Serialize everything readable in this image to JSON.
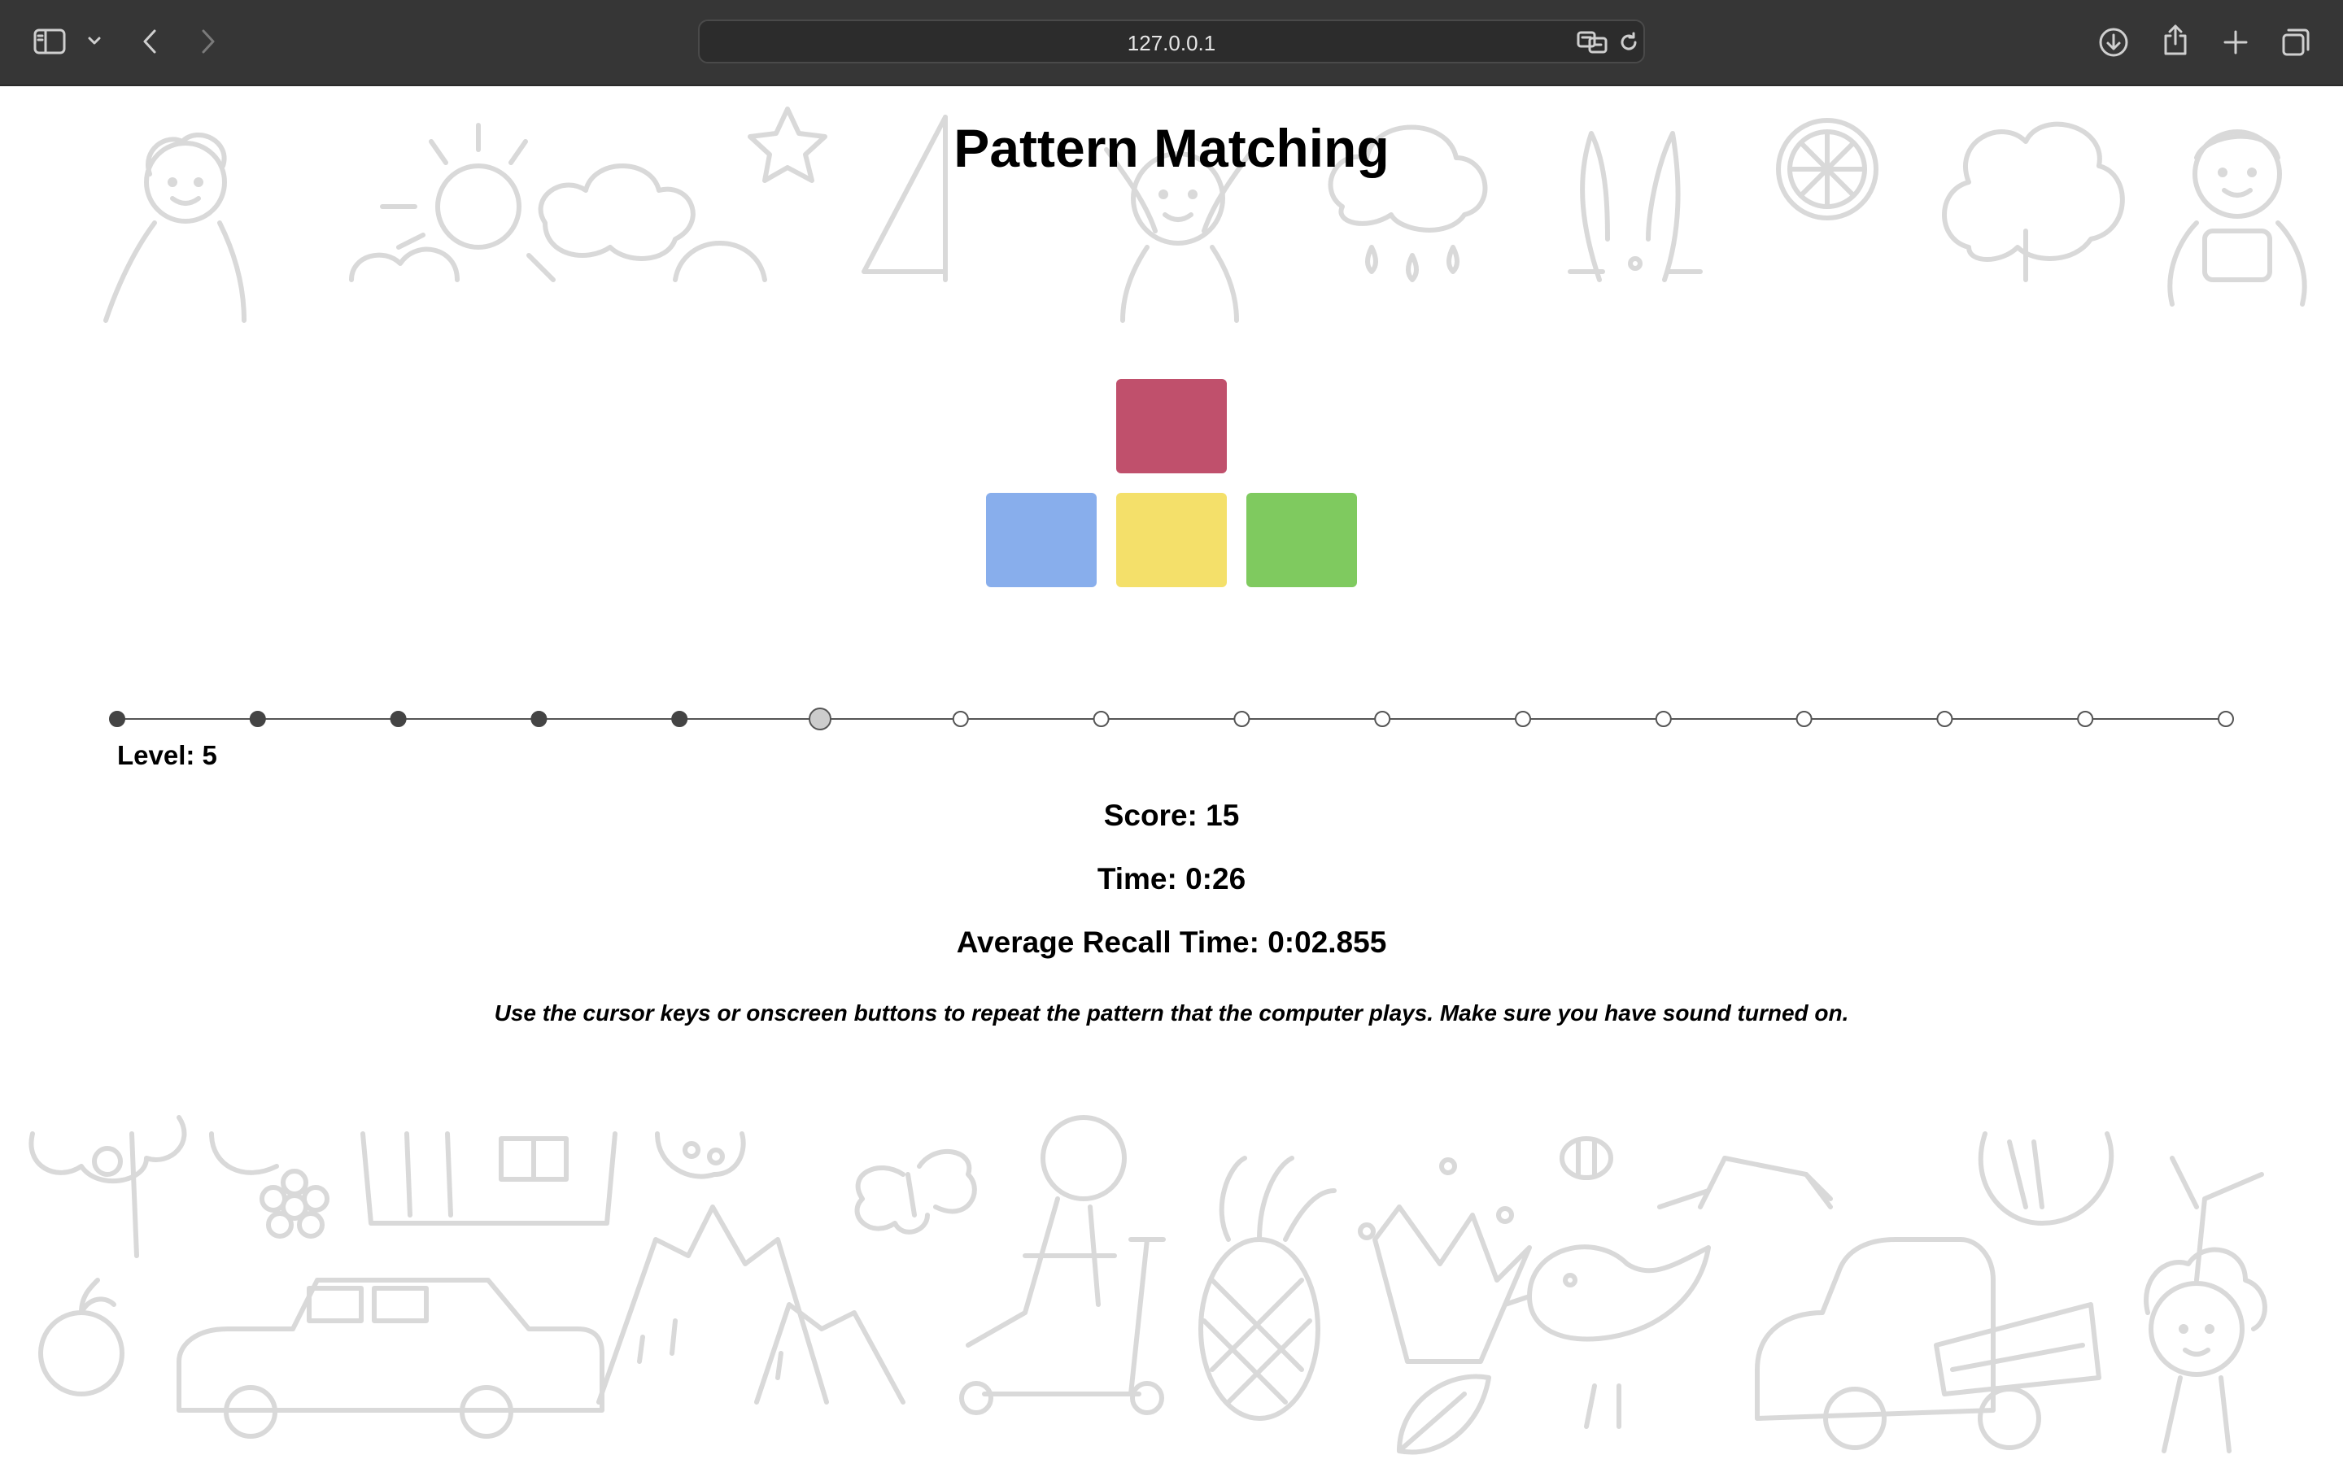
{
  "browser": {
    "url": "127.0.0.1",
    "toolbar_icons": [
      "sidebar-icon",
      "chevron-down-icon",
      "back-icon",
      "forward-icon",
      "translate-icon",
      "reload-icon",
      "download-icon",
      "share-icon",
      "new-tab-icon",
      "tabs-overview-icon"
    ]
  },
  "page": {
    "title": "Pattern Matching"
  },
  "pads": {
    "up": {
      "color": "#c0506c"
    },
    "left": {
      "color": "#88aeec"
    },
    "down": {
      "color": "#f4e06a"
    },
    "right": {
      "color": "#7fca5f"
    }
  },
  "progress": {
    "total_levels": 16,
    "current_level": 6
  },
  "level_label": "Level: 5",
  "stats": {
    "score": "Score: 15",
    "time": "Time: 0:26",
    "avg_recall": "Average Recall Time: 0:02.855"
  },
  "instructions": "Use the cursor keys or onscreen buttons to repeat the pattern that the computer plays. Make sure you have sound turned on.",
  "colors": {
    "toolbar_bg": "#363636",
    "doodle_stroke": "#d9d9d9",
    "progress_done": "#444444",
    "progress_current": "#cccccc"
  }
}
